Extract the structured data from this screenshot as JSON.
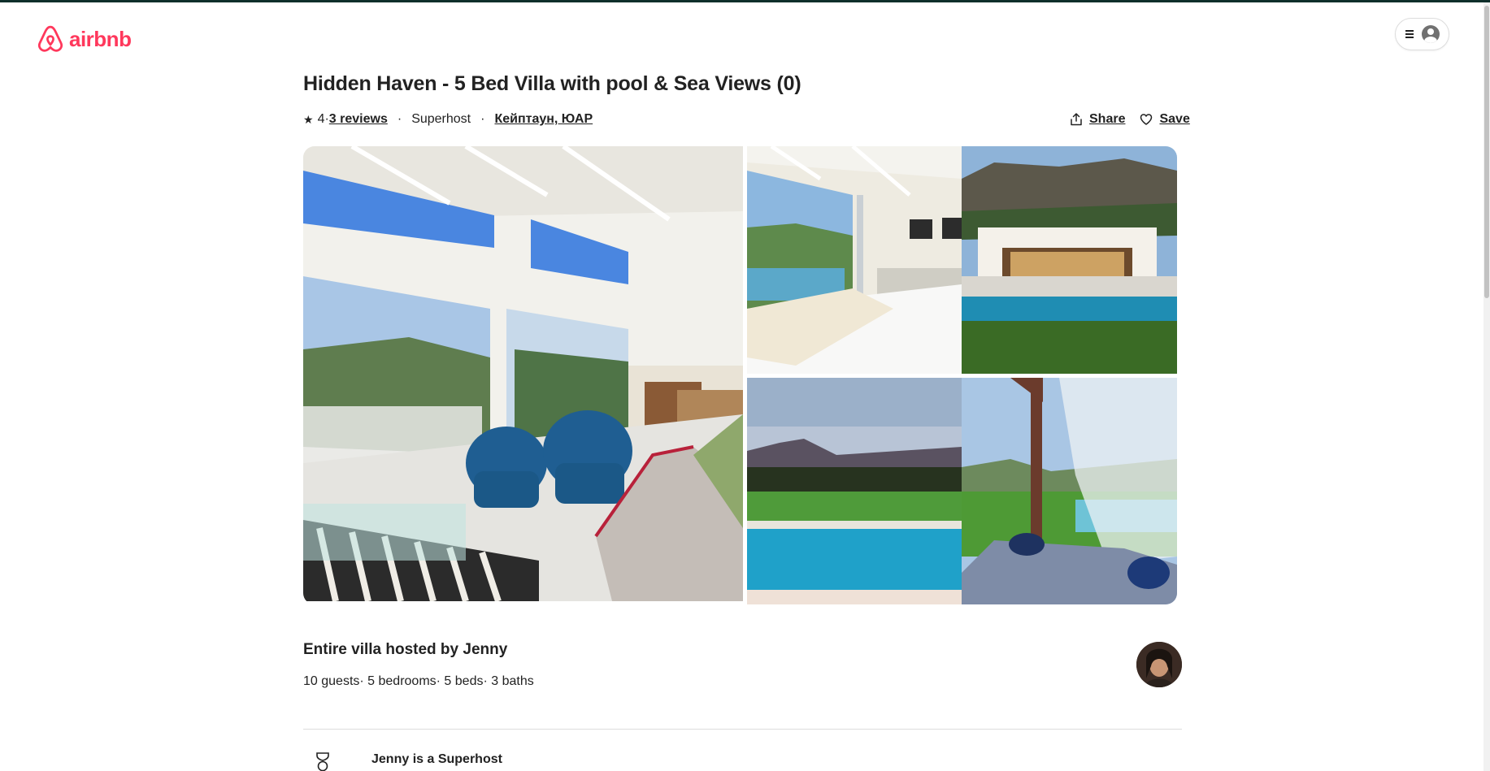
{
  "header": {
    "logo_text": "airbnb",
    "logo_icon": "airbnb-logo-icon",
    "menu_icon": "hamburger-icon",
    "profile_icon": "user-avatar-icon"
  },
  "listing": {
    "title": "Hidden Haven - 5 Bed Villa with pool & Sea Views (0)",
    "rating": "4",
    "reviews_link": "3 reviews",
    "superhost": "Superhost",
    "location": "Кейптаун, ЮАР"
  },
  "actions": {
    "share": "Share",
    "save": "Save"
  },
  "gallery": {
    "photos": [
      "living-room",
      "bedroom",
      "villa-exterior-pool",
      "pool-mountain-view",
      "daybed-garden"
    ]
  },
  "host": {
    "title": "Entire villa hosted by Jenny",
    "details": "10 guests· 5 bedrooms· 5 beds· 3 baths"
  },
  "highlights": {
    "superhost_title": "Jenny is a Superhost"
  },
  "colors": {
    "brand": "#ff385c",
    "text": "#222222",
    "divider": "#dddddd"
  }
}
